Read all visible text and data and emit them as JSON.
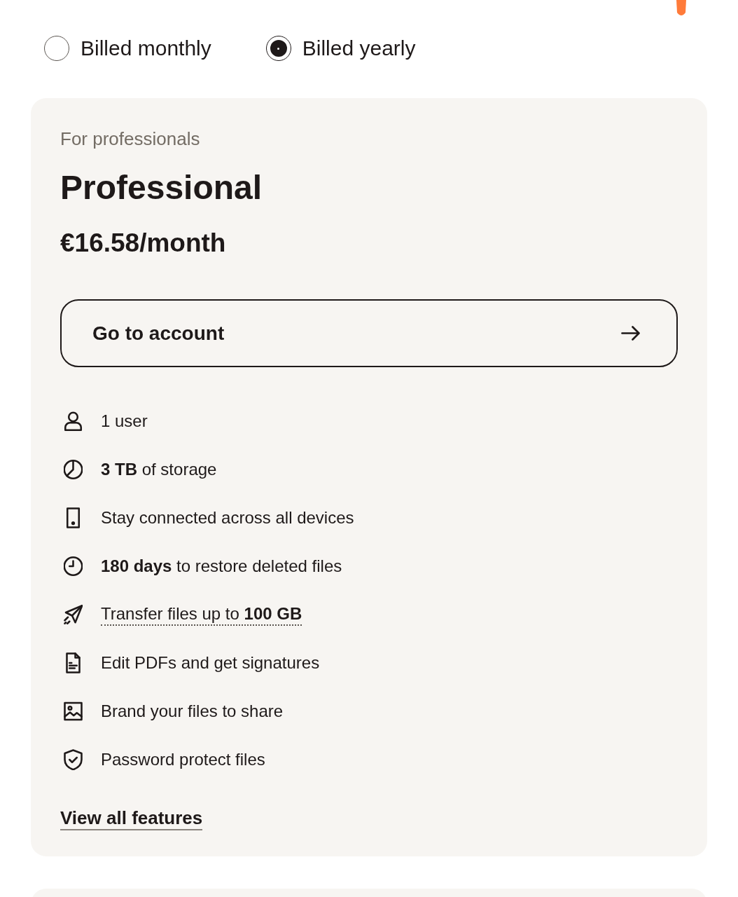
{
  "billing_options": [
    {
      "label": "Billed monthly",
      "selected": false
    },
    {
      "label": "Billed yearly",
      "selected": true
    }
  ],
  "plan": {
    "eyebrow": "For professionals",
    "name": "Professional",
    "price": "€16.58/month",
    "button": {
      "label": "Go to account"
    },
    "features": [
      {
        "text": "1 user",
        "tooltip": false
      },
      {
        "text": "**3 TB** of storage",
        "tooltip": false
      },
      {
        "text": "Stay connected across all devices",
        "tooltip": false
      },
      {
        "text": "**180 days** to restore deleted files",
        "tooltip": false
      },
      {
        "text": "Transfer files up to **100 GB**",
        "tooltip": true
      },
      {
        "text": "Edit PDFs and get signatures",
        "tooltip": false
      },
      {
        "text": "Brand your files to share",
        "tooltip": false
      },
      {
        "text": "Password protect files",
        "tooltip": false
      }
    ],
    "link": "View all features"
  }
}
